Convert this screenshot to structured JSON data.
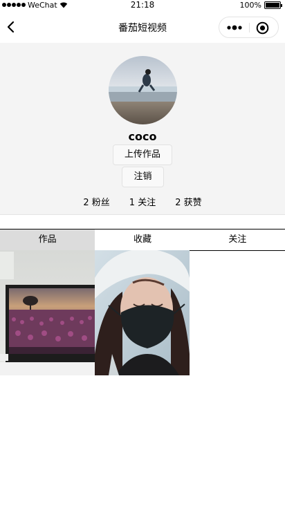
{
  "status_bar": {
    "carrier": "WeChat",
    "time": "21:18",
    "battery": "100%",
    "battery_level": 1.0
  },
  "nav": {
    "title": "番茄短视频"
  },
  "profile": {
    "username": "coco",
    "upload_label": "上传作品",
    "logout_label": "注销",
    "stats": [
      {
        "count": "2",
        "label": "粉丝"
      },
      {
        "count": "1",
        "label": "关注"
      },
      {
        "count": "2",
        "label": "获赞"
      }
    ]
  },
  "tabs": [
    {
      "label": "作品",
      "active": true
    },
    {
      "label": "收藏",
      "active": false
    },
    {
      "label": "关注",
      "active": false
    }
  ],
  "videos": [
    {
      "thumbnail": "monitor-tulip-field"
    },
    {
      "thumbnail": "woman-face-mask"
    }
  ]
}
